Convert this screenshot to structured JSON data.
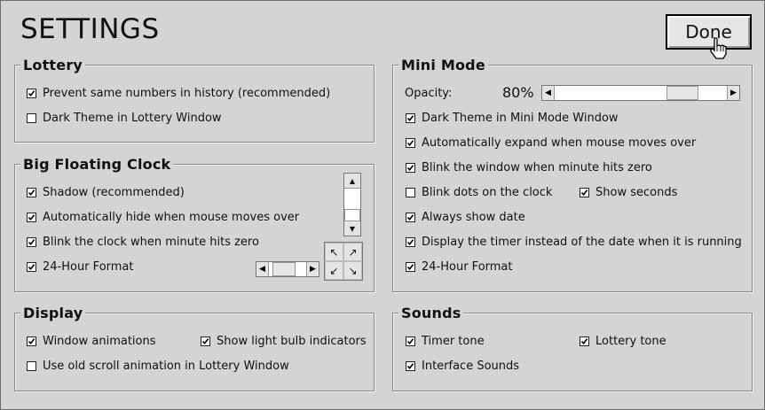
{
  "header": {
    "title": "SETTINGS",
    "done_label": "Done"
  },
  "lottery": {
    "legend": "Lottery",
    "items": [
      {
        "label": "Prevent same numbers in history (recommended)",
        "checked": true
      },
      {
        "label": "Dark Theme in Lottery Window",
        "checked": false
      }
    ]
  },
  "clock": {
    "legend": "Big Floating Clock",
    "items": [
      {
        "label": "Shadow (recommended)",
        "checked": true
      },
      {
        "label": "Automatically hide when mouse moves over",
        "checked": true
      },
      {
        "label": "Blink the clock when minute hits zero",
        "checked": true
      },
      {
        "label": "24-Hour Format",
        "checked": true
      }
    ],
    "direction_pad": [
      "↖",
      "↗",
      "↙",
      "↘"
    ]
  },
  "display": {
    "legend": "Display",
    "items": [
      {
        "label": "Window animations",
        "checked": true
      },
      {
        "label": "Show light bulb indicators",
        "checked": true
      },
      {
        "label": "Use old scroll animation in Lottery Window",
        "checked": false
      }
    ]
  },
  "mini": {
    "legend": "Mini Mode",
    "opacity_label": "Opacity:",
    "opacity_value": "80%",
    "opacity_fraction": 0.8,
    "items": [
      {
        "label": "Dark Theme in Mini Mode Window",
        "checked": true
      },
      {
        "label": "Automatically expand when mouse moves over",
        "checked": true
      },
      {
        "label": "Blink the window when minute hits zero",
        "checked": true
      },
      {
        "label": "Blink dots on the clock",
        "checked": false
      },
      {
        "label": "Show seconds",
        "checked": true
      },
      {
        "label": "Always show date",
        "checked": true
      },
      {
        "label": "Display the timer instead of the date when it is running",
        "checked": true
      },
      {
        "label": "24-Hour Format",
        "checked": true
      }
    ]
  },
  "sounds": {
    "legend": "Sounds",
    "items": [
      {
        "label": "Timer tone",
        "checked": true
      },
      {
        "label": "Lottery tone",
        "checked": true
      },
      {
        "label": "Interface Sounds",
        "checked": true
      }
    ]
  },
  "colors": {
    "background": "#d4d4d4",
    "border": "#888888",
    "button_face": "#e6e6e6"
  }
}
